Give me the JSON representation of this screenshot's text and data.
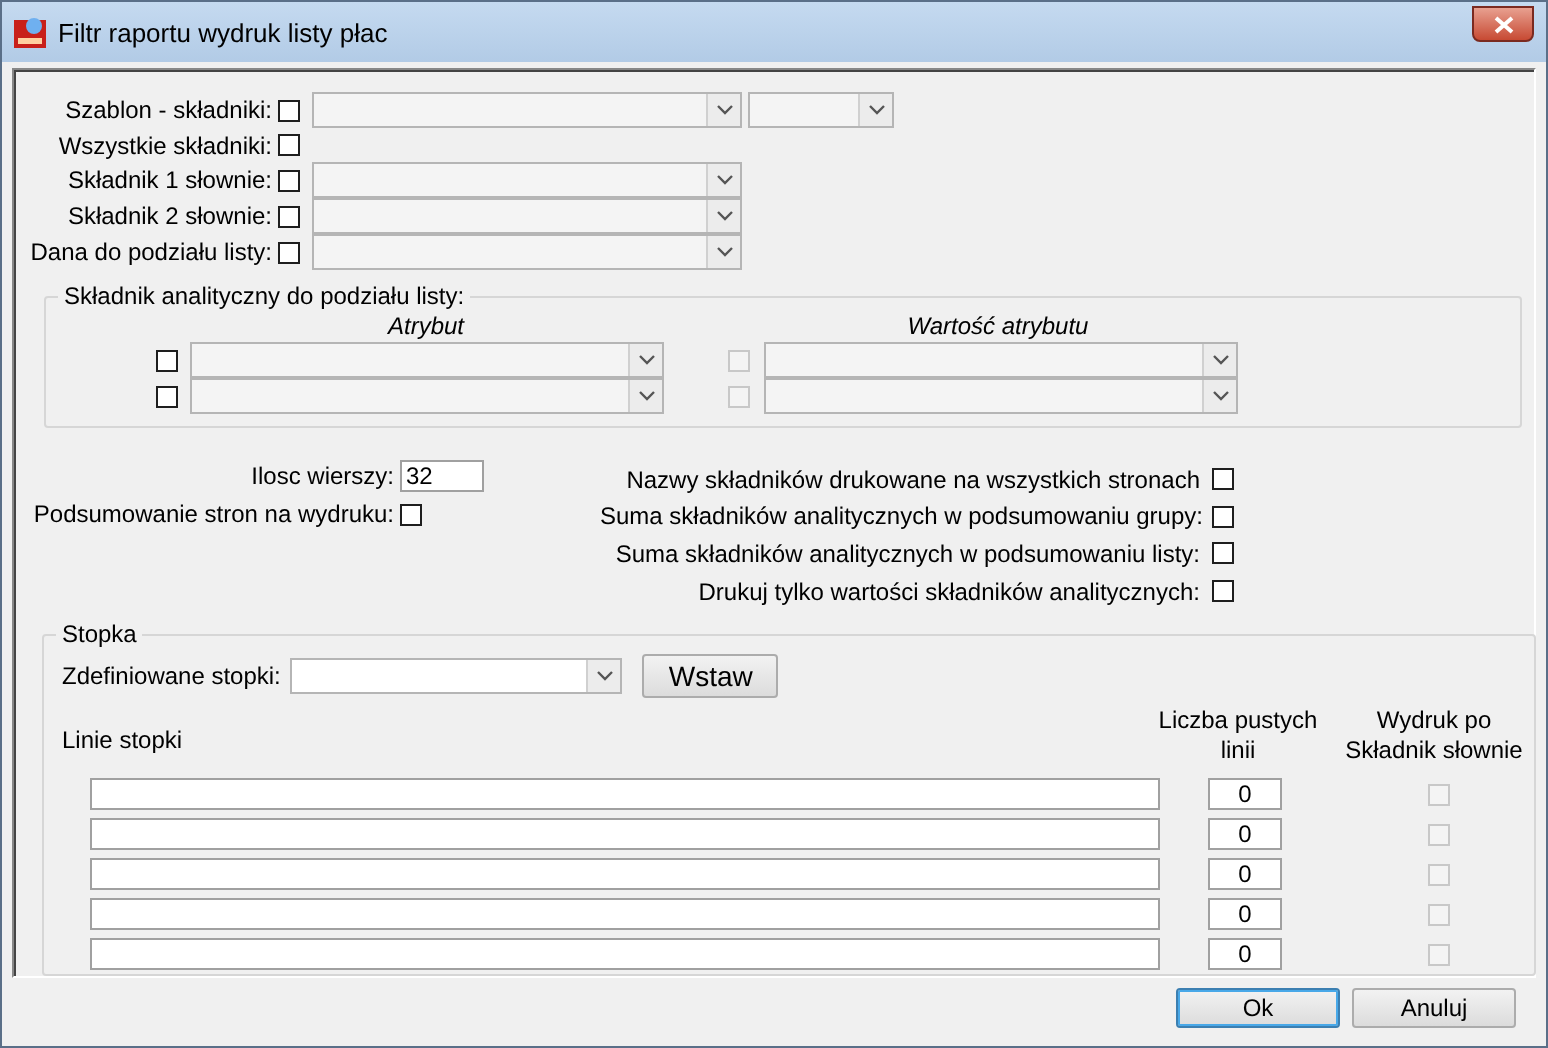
{
  "window": {
    "title": "Filtr raportu wydruk listy płac"
  },
  "fields": [
    {
      "kind": "double_combo",
      "label": "Szablon - składniki:",
      "checked": false
    },
    {
      "kind": "checkbox",
      "label": "Wszystkie składniki:",
      "checked": false
    },
    {
      "kind": "combo",
      "label": "Składnik 1 słownie:",
      "checked": false
    },
    {
      "kind": "combo",
      "label": "Składnik 2 słownie:",
      "checked": false
    },
    {
      "kind": "combo",
      "label": "Dana do podziału listy:",
      "checked": false
    }
  ],
  "analytic": {
    "title": "Składnik analityczny do podziału listy:",
    "attribute_header": "Atrybut",
    "value_header": "Wartość atrybutu",
    "rows": [
      {
        "checked": false,
        "value_checked": false,
        "value_disabled": true
      },
      {
        "checked": false,
        "value_checked": false,
        "value_disabled": true
      }
    ]
  },
  "row_count": {
    "label": "Ilosc wierszy:",
    "value": "32"
  },
  "page_summary": {
    "label": "Podsumowanie stron na wydruku:",
    "checked": false
  },
  "options": [
    {
      "label": "Nazwy składników drukowane na wszystkich stronach",
      "checked": false
    },
    {
      "label": "Suma składników analitycznych w podsumowaniu grupy:",
      "checked": false
    },
    {
      "label": "Suma składników analitycznych w podsumowaniu listy:",
      "checked": false
    },
    {
      "label": "Drukuj tylko wartości składników analitycznych:",
      "checked": false
    }
  ],
  "footer": {
    "title": "Stopka",
    "defined_label": "Zdefiniowane stopki:",
    "insert_button": "Wstaw",
    "lines_label": "Linie stopki",
    "empty_lines_header": "Liczba pustych linii",
    "print_header": "Wydruk po Składnik słownie",
    "lines": [
      {
        "empty_lines": "0",
        "print_checked": false,
        "print_disabled": true
      },
      {
        "empty_lines": "0",
        "print_checked": false,
        "print_disabled": true
      },
      {
        "empty_lines": "0",
        "print_checked": false,
        "print_disabled": true
      },
      {
        "empty_lines": "0",
        "print_checked": false,
        "print_disabled": true
      },
      {
        "empty_lines": "0",
        "print_checked": false,
        "print_disabled": true
      }
    ]
  },
  "buttons": [
    {
      "label": "Ok",
      "default": true
    },
    {
      "label": "Anuluj",
      "default": false
    }
  ]
}
